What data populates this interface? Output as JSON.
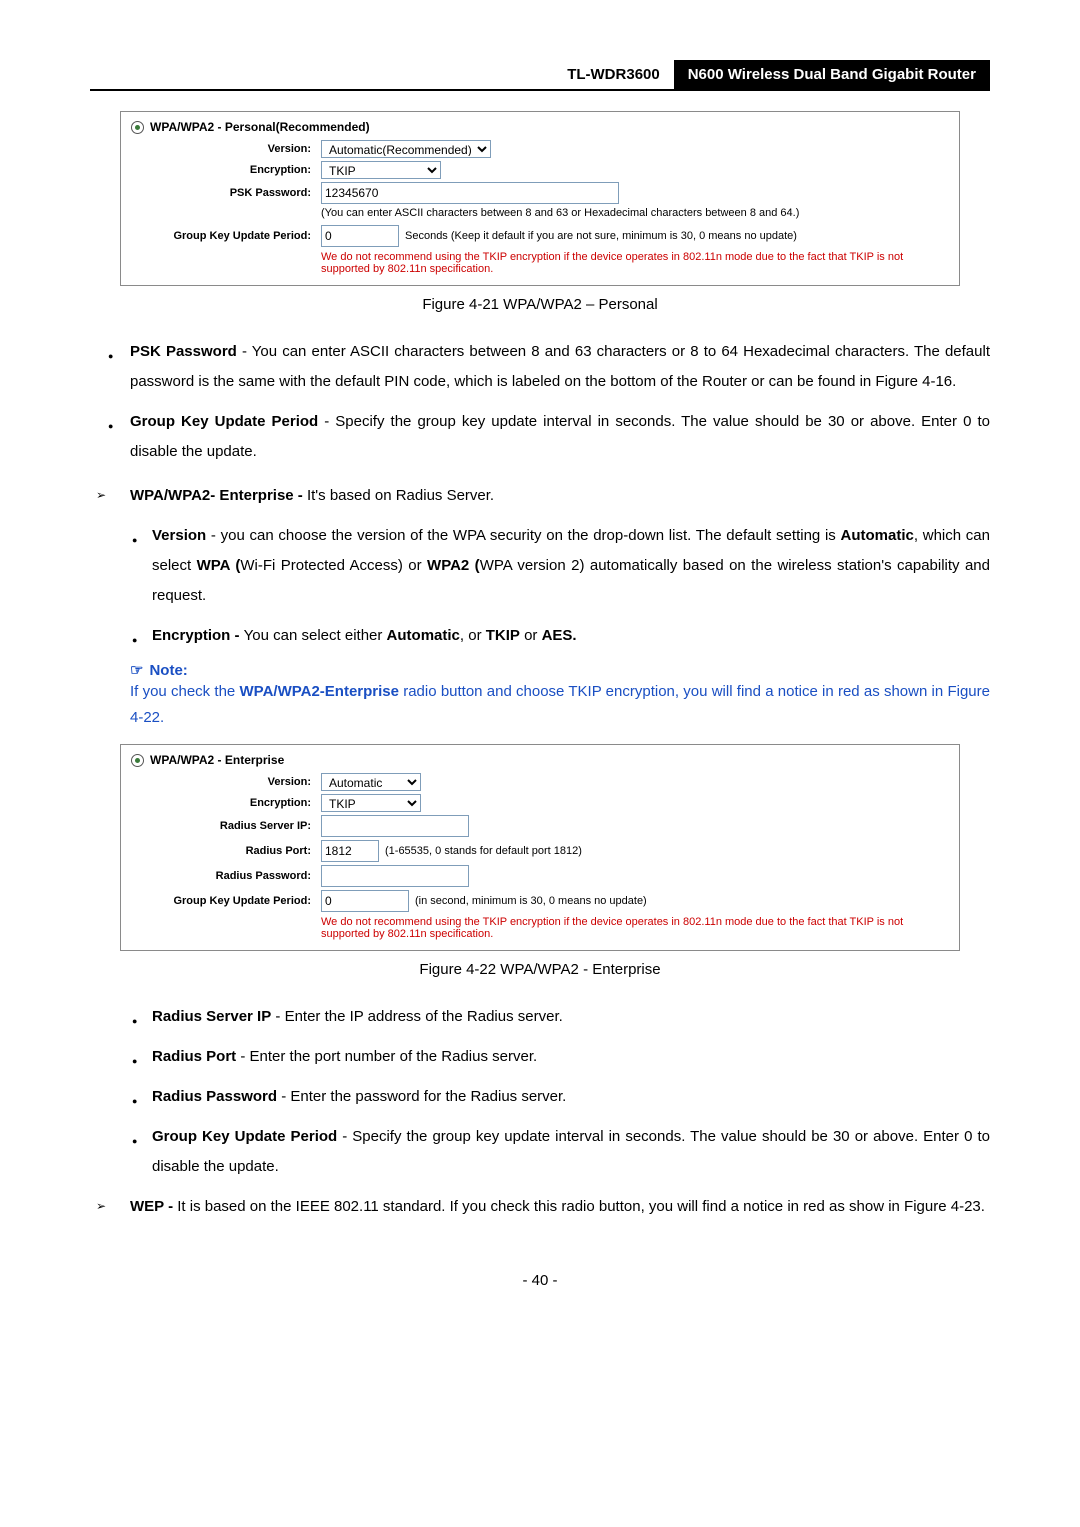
{
  "header": {
    "model": "TL-WDR3600",
    "title": "N600 Wireless Dual Band Gigabit Router"
  },
  "fig1": {
    "section": "WPA/WPA2 - Personal(Recommended)",
    "versionLabel": "Version:",
    "versionValue": "Automatic(Recommended)",
    "encLabel": "Encryption:",
    "encValue": "TKIP",
    "pskLabel": "PSK Password:",
    "pskValue": "12345670",
    "pskHint": "(You can enter ASCII characters between 8 and 63 or Hexadecimal characters between 8 and 64.)",
    "gkupLabel": "Group Key Update Period:",
    "gkupValue": "0",
    "gkupHint": "Seconds (Keep it default if you are not sure, minimum is 30, 0 means no update)",
    "warn": "We do not recommend using the TKIP encryption if the device operates in 802.11n mode due to the fact that TKIP is not supported by 802.11n specification.",
    "caption": "Figure 4-21 WPA/WPA2 – Personal"
  },
  "bullets1": {
    "pskTitle": "PSK Password",
    "pskBody": " - You can enter ASCII characters between 8 and 63 characters or 8 to 64 Hexadecimal characters. The default password is the same with the default PIN code, which is labeled on the bottom of the Router or can be found in Figure 4-16.",
    "gkupTitle": "Group Key Update Period",
    "gkupBody": " - Specify the group key update interval in seconds. The value should be 30 or above. Enter 0 to disable the update."
  },
  "enterprise": {
    "heading": "WPA/WPA2- Enterprise - ",
    "headingTail": "It's based on Radius Server.",
    "versionTitle": "Version",
    "versionBody1": " - you can choose the version of the WPA security on the drop-down list. The default setting is ",
    "versionBold1": "Automatic",
    "versionBody2": ", which can select ",
    "versionBold2": "WPA (",
    "versionBody3": "Wi-Fi Protected Access) or ",
    "versionBold3": "WPA2 (",
    "versionBody4": "WPA version 2) automatically based on the wireless station's capability and request.",
    "encTitle": "Encryption - ",
    "encBody1": " You can select either ",
    "encBold1": "Automatic",
    "encBody2": ", or ",
    "encBold2": "TKIP",
    "encBody3": " or ",
    "encBold3": "AES."
  },
  "note": {
    "head": "Note:",
    "body1": "If you check the ",
    "bold": "WPA/WPA2-Enterprise",
    "body2": " radio button and choose TKIP encryption, you will find a notice in red as shown in Figure 4-22."
  },
  "fig2": {
    "section": "WPA/WPA2 - Enterprise",
    "versionLabel": "Version:",
    "versionValue": "Automatic",
    "encLabel": "Encryption:",
    "encValue": "TKIP",
    "rsipLabel": "Radius Server IP:",
    "rsipValue": "",
    "rportLabel": "Radius Port:",
    "rportValue": "1812",
    "rportHint": "(1-65535, 0 stands for default port 1812)",
    "rpwdLabel": "Radius Password:",
    "rpwdValue": "",
    "gkupLabel": "Group Key Update Period:",
    "gkupValue": "0",
    "gkupHint": "(in second, minimum is 30, 0 means no update)",
    "warn": "We do not recommend using the TKIP encryption if the device operates in 802.11n mode due to the fact that TKIP is not supported by 802.11n specification.",
    "caption": "Figure 4-22 WPA/WPA2 - Enterprise"
  },
  "bullets2": {
    "rsipTitle": "Radius Server IP",
    "rsipBody": " - Enter the IP address of the Radius server.",
    "rportTitle": "Radius Port",
    "rportBody": " - Enter the port number of the Radius server.",
    "rpwdTitle": "Radius Password",
    "rpwdBody": " - Enter the password for the Radius server.",
    "gkupTitle": "Group Key Update Period",
    "gkupBody": " - Specify the group key update interval in seconds. The value should be 30 or above. Enter 0 to disable the update."
  },
  "wep": {
    "title": "WEP - ",
    "body": "It is based on the IEEE 802.11 standard. If you check this radio button, you will find a notice in red as show in Figure 4-23."
  },
  "pageNumber": "- 40 -"
}
